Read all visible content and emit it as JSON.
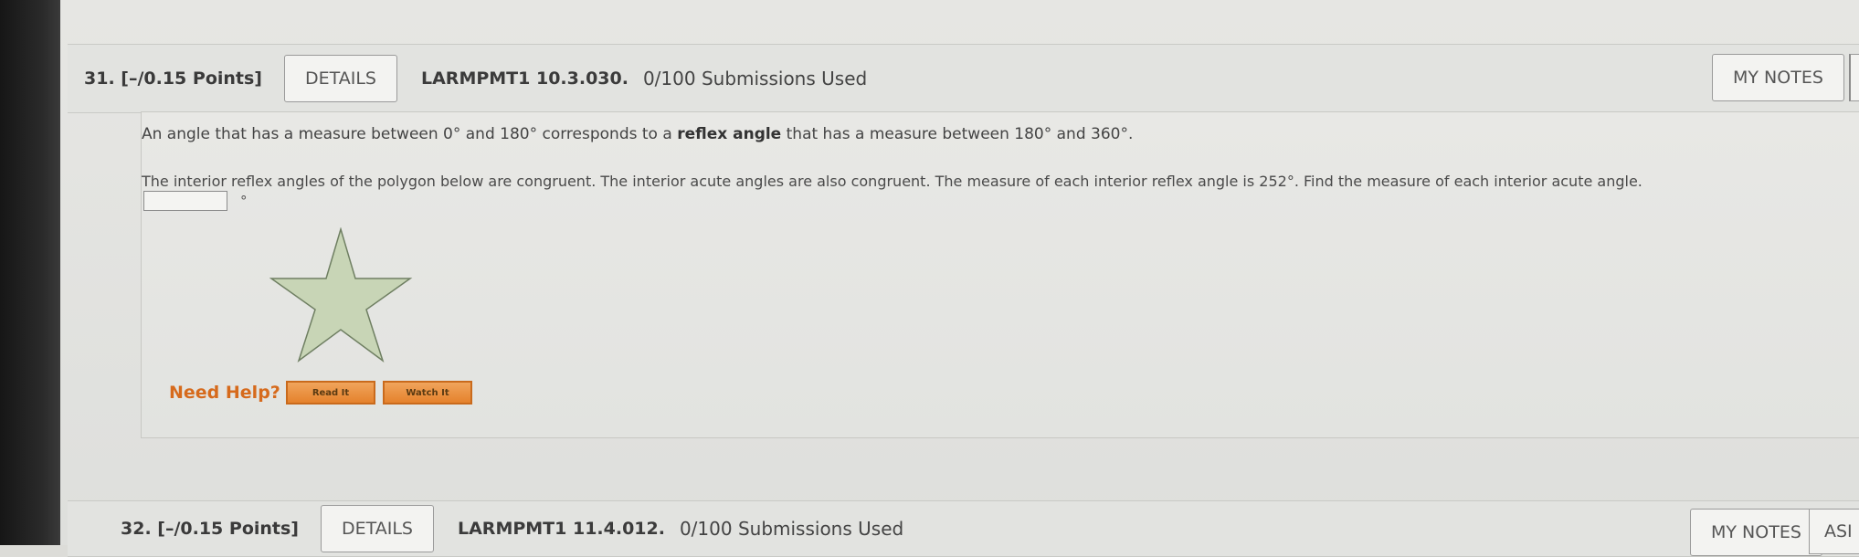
{
  "q31": {
    "number": "31. [–/0.15 Points]",
    "details_label": "DETAILS",
    "problem_code": "LARMPMT1 10.3.030.",
    "submissions": "0/100 Submissions Used",
    "my_notes_label": "MY NOTES",
    "intro_pre": "An angle that has a measure between 0° and 180° corresponds to a ",
    "intro_bold": "reflex angle",
    "intro_post": " that has a measure between 180° and 360°.",
    "prompt": "The interior reflex angles of the polygon below are congruent. The interior acute angles are also congruent. The measure of each interior reflex angle is 252°. Find the measure of each interior acute angle.",
    "answer_value": "",
    "answer_unit": "°",
    "star_fill": "#c8d5b6",
    "star_stroke": "#6f7f62",
    "need_help_label": "Need Help?",
    "read_it_label": "Read It",
    "watch_it_label": "Watch It"
  },
  "q32": {
    "number": "32. [–/0.15 Points]",
    "details_label": "DETAILS",
    "problem_code": "LARMPMT1 11.4.012.",
    "submissions": "0/100 Submissions Used",
    "my_notes_label": "MY NOTES",
    "ask_label": "ASI"
  }
}
